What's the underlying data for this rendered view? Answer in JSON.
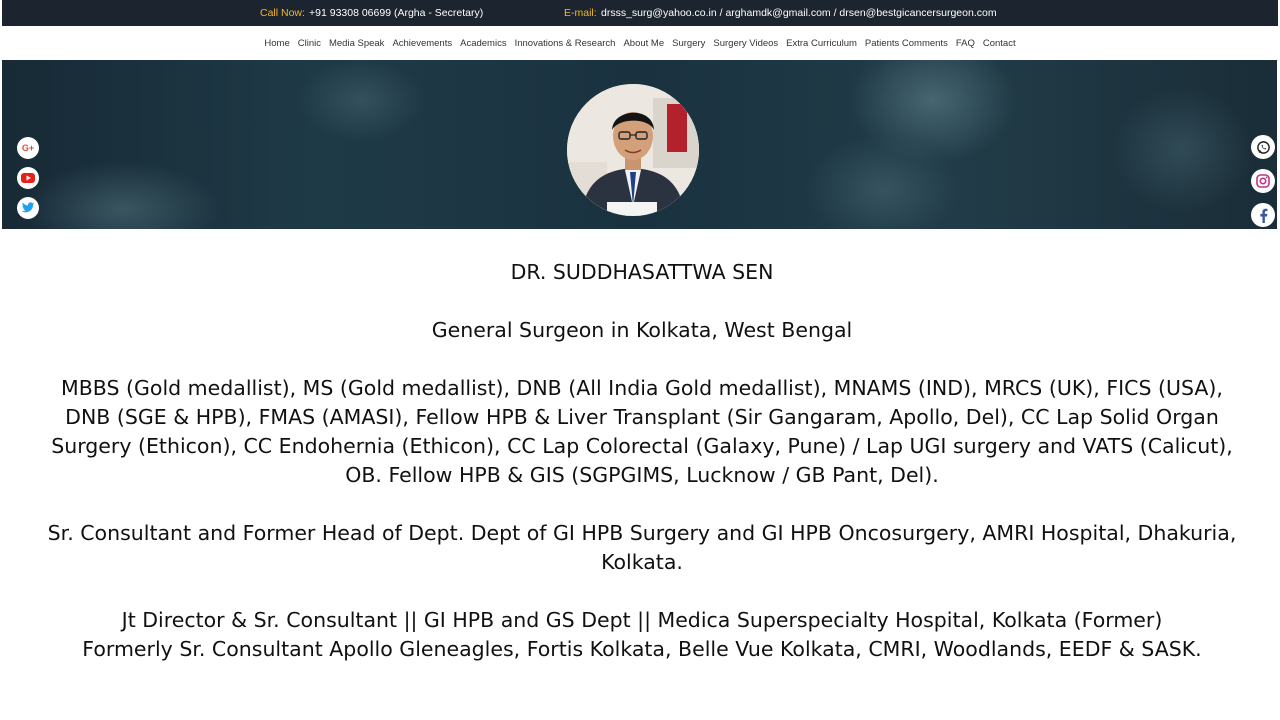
{
  "topbar": {
    "call_label": "Call Now:",
    "call_value": "+91 93308 06699 (Argha - Secretary)",
    "email_label": "E-mail:",
    "email_value": "drsss_surg@yahoo.co.in / arghamdk@gmail.com / drsen@bestgicancersurgeon.com"
  },
  "nav": {
    "items": [
      "Home",
      "Clinic",
      "Media Speak",
      "Achievements",
      "Academics",
      "Innovations & Research",
      "About Me",
      "Surgery",
      "Surgery Videos",
      "Extra Curriculum",
      "Patients Comments",
      "FAQ",
      "Contact"
    ]
  },
  "social_left": [
    "google-plus-icon",
    "youtube-icon",
    "twitter-icon"
  ],
  "social_right": [
    "whatsapp-icon",
    "instagram-icon",
    "facebook-icon"
  ],
  "colors": {
    "topbar_bg": "#1c2430",
    "label_accent": "#f5b820",
    "google": "#dd4b39",
    "youtube": "#e62117",
    "twitter": "#1da1f2",
    "whatsapp": "#222222",
    "instagram": "#c13584",
    "facebook": "#3b5998"
  },
  "content": {
    "name": "DR. SUDDHASATTWA SEN",
    "role": "General Surgeon in Kolkata, West Bengal",
    "qualifications": "MBBS (Gold medallist), MS (Gold medallist), DNB (All India Gold medallist), MNAMS (IND), MRCS (UK), FICS (USA), DNB (SGE & HPB), FMAS (AMASI), Fellow HPB & Liver Transplant (Sir Gangaram, Apollo, Del), CC Lap Solid Organ Surgery (Ethicon), CC Endohernia (Ethicon), CC Lap Colorectal (Galaxy, Pune) / Lap UGI surgery and VATS (Calicut), OB. Fellow HPB & GIS (SGPGIMS, Lucknow / GB Pant, Del).",
    "current_position": "Sr. Consultant and Former Head of Dept. Dept of GI HPB Surgery and GI HPB Oncosurgery, AMRI Hospital, Dhakuria, Kolkata.",
    "former_line1": "Jt Director & Sr. Consultant || GI HPB and GS Dept || Medica Superspecialty Hospital, Kolkata (Former)",
    "former_line2": "Formerly Sr. Consultant Apollo Gleneagles, Fortis Kolkata, Belle Vue Kolkata, CMRI, Woodlands, EEDF & SASK."
  }
}
